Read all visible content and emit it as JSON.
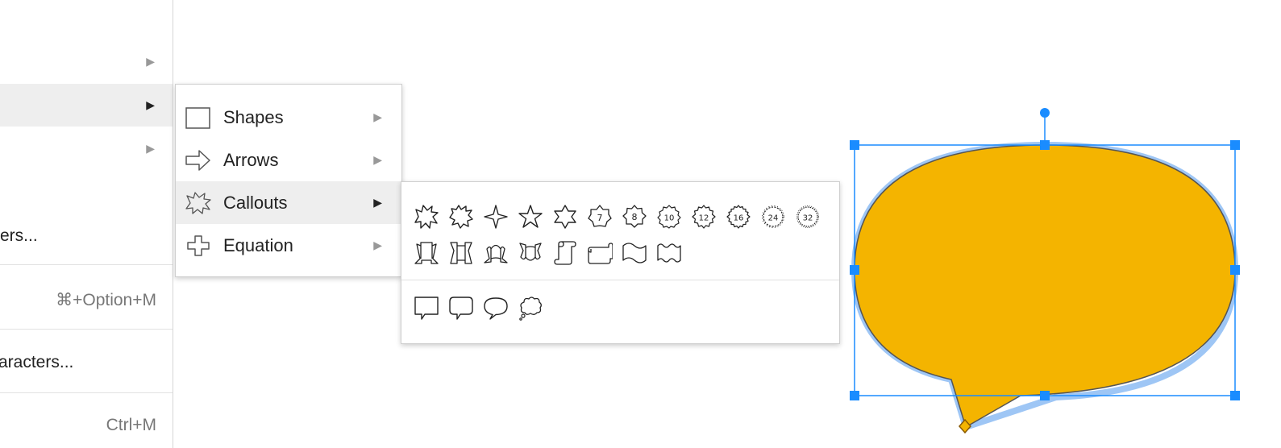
{
  "main_menu": {
    "row_text_fragment": "ers...",
    "shortcut_1": "⌘+Option+M",
    "row_text_fragment_2": "aracters...",
    "shortcut_2": "Ctrl+M"
  },
  "insert_submenu": {
    "items": [
      {
        "label": "Shapes",
        "icon": "rectangle-icon"
      },
      {
        "label": "Arrows",
        "icon": "arrow-right-icon"
      },
      {
        "label": "Callouts",
        "icon": "explosion-icon"
      },
      {
        "label": "Equation",
        "icon": "plus-icon"
      }
    ]
  },
  "callouts_panel": {
    "badge_numbers": [
      "7",
      "8",
      "10",
      "12",
      "16",
      "24",
      "32"
    ]
  },
  "selection": {
    "shape_fill": "#f4b400",
    "selection_color": "#1a8cff",
    "adjust_handle_color": "#f4b400"
  }
}
